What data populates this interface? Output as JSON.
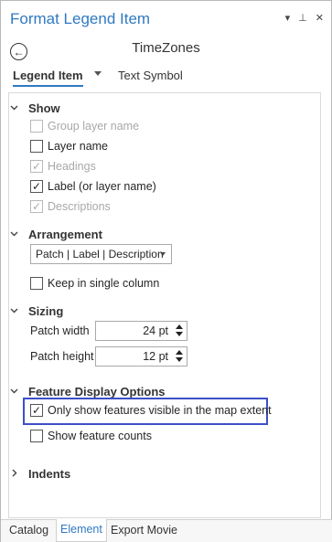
{
  "pane": {
    "title": "Format Legend Item",
    "tools": {
      "menu": "▾",
      "pin": "⊥",
      "close": "✕"
    },
    "layer_name": "TimeZones"
  },
  "tabs": {
    "legend_item": "Legend Item",
    "text_symbol": "Text Symbol"
  },
  "show": {
    "heading": "Show",
    "items": [
      {
        "label": "Group layer name",
        "checked": false,
        "disabled": true
      },
      {
        "label": "Layer name",
        "checked": false,
        "disabled": false
      },
      {
        "label": "Headings",
        "checked": true,
        "disabled": true
      },
      {
        "label": "Label (or layer name)",
        "checked": true,
        "disabled": false
      },
      {
        "label": "Descriptions",
        "checked": true,
        "disabled": true
      }
    ]
  },
  "arrangement": {
    "heading": "Arrangement",
    "selected": "Patch | Label | Description",
    "keep_single_column": "Keep in single column"
  },
  "sizing": {
    "heading": "Sizing",
    "patch_width_label": "Patch width",
    "patch_width_value": "24 pt",
    "patch_height_label": "Patch height",
    "patch_height_value": "12 pt"
  },
  "feature_display": {
    "heading": "Feature Display Options",
    "only_visible": "Only show features visible in the map extent",
    "show_counts": "Show feature counts"
  },
  "indents": {
    "heading": "Indents"
  },
  "bottom_tabs": [
    "Catalog",
    "Element",
    "Export Movie"
  ],
  "colors": {
    "accent": "#2f79c2",
    "highlight_box": "#3c4fc7"
  }
}
